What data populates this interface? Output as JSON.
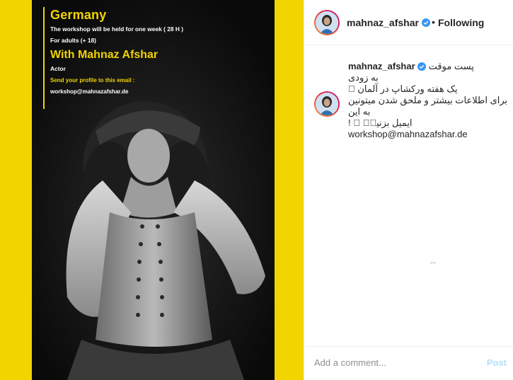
{
  "poster": {
    "country": "Germany",
    "duration": "The workshop will be held for one week ( 28 H )",
    "audience": "For adults (+ 18)",
    "with_name": "With Mahnaz Afshar",
    "role": "Actor",
    "send_profile": "Send your profile to this email :",
    "email": "workshop@mahnazafshar.de"
  },
  "header": {
    "username": "mahnaz_afshar",
    "separator": "•",
    "follow_status": "Following"
  },
  "caption": {
    "username": "mahnaz_afshar",
    "line1": "پست موقت",
    "line2": "به زودی",
    "line3": "یک هفته ورکشاپ در آلمان ⃞",
    "line4": "برای اطلاعات بیشتر و ملحق شدن میتونین به این",
    "line5": "ایمیل بزنین⃞ ⃞ !",
    "email": "workshop@mahnazafshar.de"
  },
  "misc": {
    "small_mark": "..."
  },
  "footer": {
    "placeholder": "Add a comment...",
    "post_label": "Post"
  },
  "colors": {
    "poster_yellow": "#f2d400",
    "verified_blue": "#3897f0",
    "post_button_disabled": "#b2dffc"
  }
}
